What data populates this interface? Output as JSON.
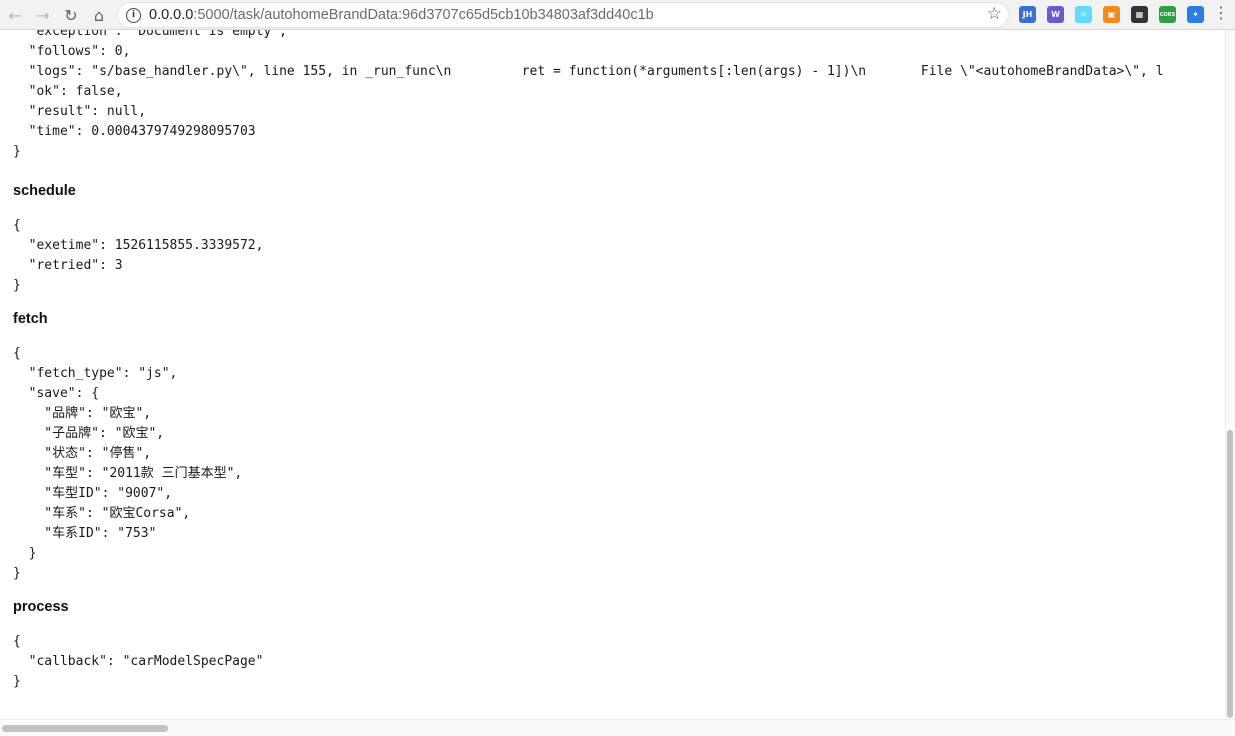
{
  "browser": {
    "url_host": "0.0.0.0",
    "url_rest": ":5000/task/autohomeBrandData:96d3707c65d5cb10b34803af3dd40c1b",
    "extensions": [
      {
        "name": "jh-extension-icon",
        "label": "JH",
        "color": "#3b6fd8"
      },
      {
        "name": "web-extension-icon",
        "label": "W",
        "color": "#6a5acd"
      },
      {
        "name": "react-devtools-icon",
        "label": "⚛",
        "color": "#61dafb"
      },
      {
        "name": "orange-extension-icon",
        "label": "▣",
        "color": "#f08c1a"
      },
      {
        "name": "qr-code-icon",
        "label": "▦",
        "color": "#333333"
      },
      {
        "name": "cors-extension-icon",
        "label": "CORS",
        "color": "#2e9e44"
      },
      {
        "name": "blue-extension-icon",
        "label": "✦",
        "color": "#2a7de1"
      }
    ]
  },
  "result_block": {
    "lines": [
      "  \"exception\": \"Document is empty\",",
      "  \"follows\": 0,",
      "  \"logs\": \"s/base_handler.py\\\", line 155, in _run_func\\n         ret = function(*arguments[:len(args) - 1])\\n       File \\\"<autohomeBrandData>\\\", l",
      "  \"ok\": false,",
      "  \"result\": null,",
      "  \"time\": 0.0004379749298095703",
      "}"
    ]
  },
  "sections": {
    "schedule": {
      "title": "schedule",
      "body": "{\n  \"exetime\": 1526115855.3339572,\n  \"retried\": 3\n}"
    },
    "fetch": {
      "title": "fetch",
      "body": "{\n  \"fetch_type\": \"js\",\n  \"save\": {\n    \"品牌\": \"欧宝\",\n    \"子品牌\": \"欧宝\",\n    \"状态\": \"停售\",\n    \"车型\": \"2011款 三门基本型\",\n    \"车型ID\": \"9007\",\n    \"车系\": \"欧宝Corsa\",\n    \"车系ID\": \"753\"\n  }\n}"
    },
    "process": {
      "title": "process",
      "body": "{\n  \"callback\": \"carModelSpecPage\"\n}"
    }
  }
}
